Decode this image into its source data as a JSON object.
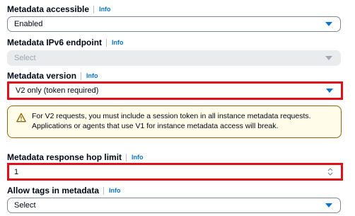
{
  "fields": {
    "metadata_accessible": {
      "label": "Metadata accessible",
      "info": "Info",
      "value": "Enabled"
    },
    "ipv6_endpoint": {
      "label": "Metadata IPv6 endpoint",
      "info": "Info",
      "placeholder": "Select"
    },
    "metadata_version": {
      "label": "Metadata version",
      "info": "Info",
      "value": "V2 only (token required)"
    },
    "hop_limit": {
      "label": "Metadata response hop limit",
      "info": "Info",
      "value": "1"
    },
    "allow_tags": {
      "label": "Allow tags in metadata",
      "info": "Info",
      "value": "Select"
    }
  },
  "alert": {
    "line1": "For V2 requests, you must include a session token in all instance metadata requests.",
    "line2": "Applications or agents that use V1 for instance metadata access will break."
  },
  "colors": {
    "highlight": "#e0101b",
    "link": "#0972d3",
    "warning_border": "#8d6605",
    "warning_bg": "#fffce9"
  }
}
